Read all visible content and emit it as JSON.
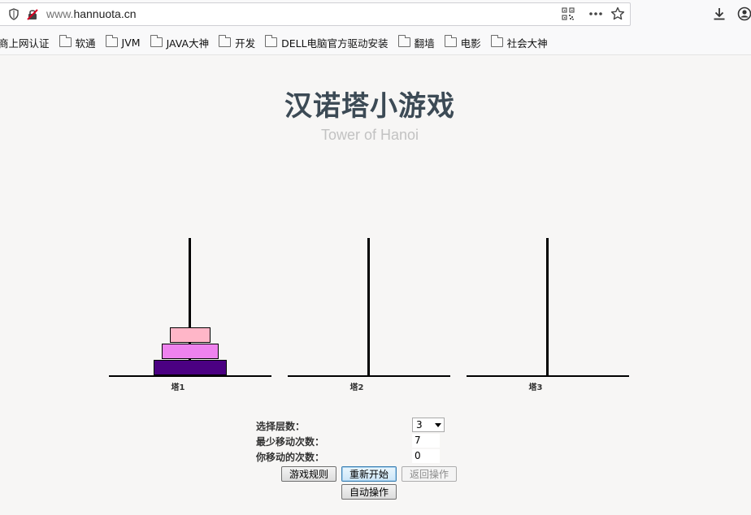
{
  "browser": {
    "url_prefix": "www.",
    "url_host": "hannuota.cn",
    "bookmarks": [
      {
        "label": "商上网认证",
        "folder": false
      },
      {
        "label": "软通",
        "folder": true
      },
      {
        "label": "JVM",
        "folder": true
      },
      {
        "label": "JAVA大神",
        "folder": true
      },
      {
        "label": "开发",
        "folder": true
      },
      {
        "label": "DELL电脑官方驱动安装",
        "folder": true
      },
      {
        "label": "翻墙",
        "folder": true
      },
      {
        "label": "电影",
        "folder": true
      },
      {
        "label": "社会大神",
        "folder": true
      }
    ]
  },
  "page": {
    "title": "汉诺塔小游戏",
    "subtitle": "Tower of Hanoi"
  },
  "towers": [
    {
      "label": "塔1"
    },
    {
      "label": "塔2"
    },
    {
      "label": "塔3"
    }
  ],
  "disks": {
    "tower_index": 0,
    "colors_top_to_bottom": [
      "#ffb6c8",
      "#ee82ee",
      "#4b0082"
    ]
  },
  "form": {
    "level_label": "选择层数：",
    "level_value": "3",
    "min_moves_label": "最少移动次数：",
    "min_moves_value": "7",
    "your_moves_label": "你移动的次数：",
    "your_moves_value": "0"
  },
  "buttons": {
    "rules": "游戏规则",
    "restart": "重新开始",
    "undo": "返回操作",
    "auto": "自动操作"
  }
}
